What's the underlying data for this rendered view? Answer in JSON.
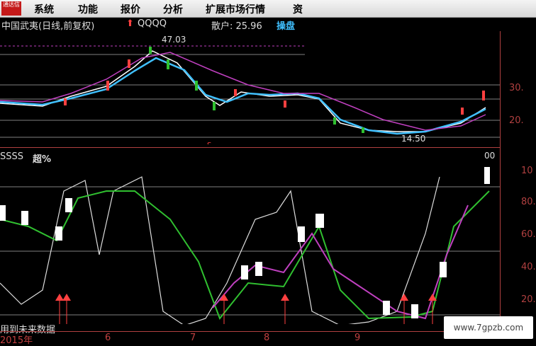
{
  "menu": {
    "logo": "通达信",
    "items": [
      "系统",
      "功能",
      "报价",
      "分析",
      "扩展市场行情",
      "资"
    ]
  },
  "header": {
    "stock_title": "中国武夷(日线,前复权)",
    "flag": "QQQQ",
    "retail_label": "散户: 25.96",
    "op_label": "操盘"
  },
  "price_panel": {
    "high_label": "47.03",
    "low_label": "14.50",
    "marker": "S",
    "y_ticks": [
      "30.",
      "20."
    ]
  },
  "indicator_panel": {
    "name": "SSSS",
    "sub_name": "超%",
    "top_value": "00",
    "y_ticks": [
      "10",
      "80.",
      "60.",
      "40.",
      "20."
    ],
    "footer_note": "用到未来数据"
  },
  "x_axis": [
    "2015年",
    "6",
    "7",
    "8",
    "9"
  ],
  "watermark": "www.7gpzb.com",
  "colors": {
    "up": "#ff4040",
    "down": "#30c030",
    "ma1": "#ffffff",
    "ma2": "#40c0ff",
    "ma3": "#c040c0",
    "axis": "#b04040"
  }
}
